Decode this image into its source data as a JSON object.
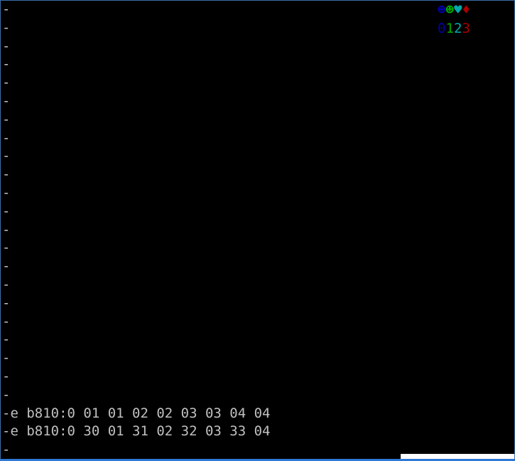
{
  "console": {
    "prompt": "-",
    "lines": [
      "-",
      "-",
      "-",
      "-",
      "-",
      "-",
      "-",
      "-",
      "-",
      "-",
      "-",
      "-",
      "-",
      "-",
      "-",
      "-",
      "-",
      "-",
      "-",
      "-",
      "-",
      "-",
      "-e b810:0 01 01 02 02 03 03 04 04",
      "-e b810:0 30 01 31 02 32 03 33 04",
      "-"
    ]
  },
  "corner": {
    "glyphs": [
      {
        "char": "☻",
        "color": "#0000aa"
      },
      {
        "char": "☻",
        "color": "#00aa00"
      },
      {
        "char": "♥",
        "color": "#00aaaa"
      },
      {
        "char": "♦",
        "color": "#aa0000"
      }
    ],
    "digits": [
      {
        "char": "0",
        "color": "#0000aa"
      },
      {
        "char": "1",
        "color": "#00aa00"
      },
      {
        "char": "2",
        "color": "#00aaaa"
      },
      {
        "char": "3",
        "color": "#aa0000"
      }
    ]
  },
  "colors": {
    "background": "#000000",
    "text": "#c0c0c0",
    "border": "#2e78d6"
  }
}
